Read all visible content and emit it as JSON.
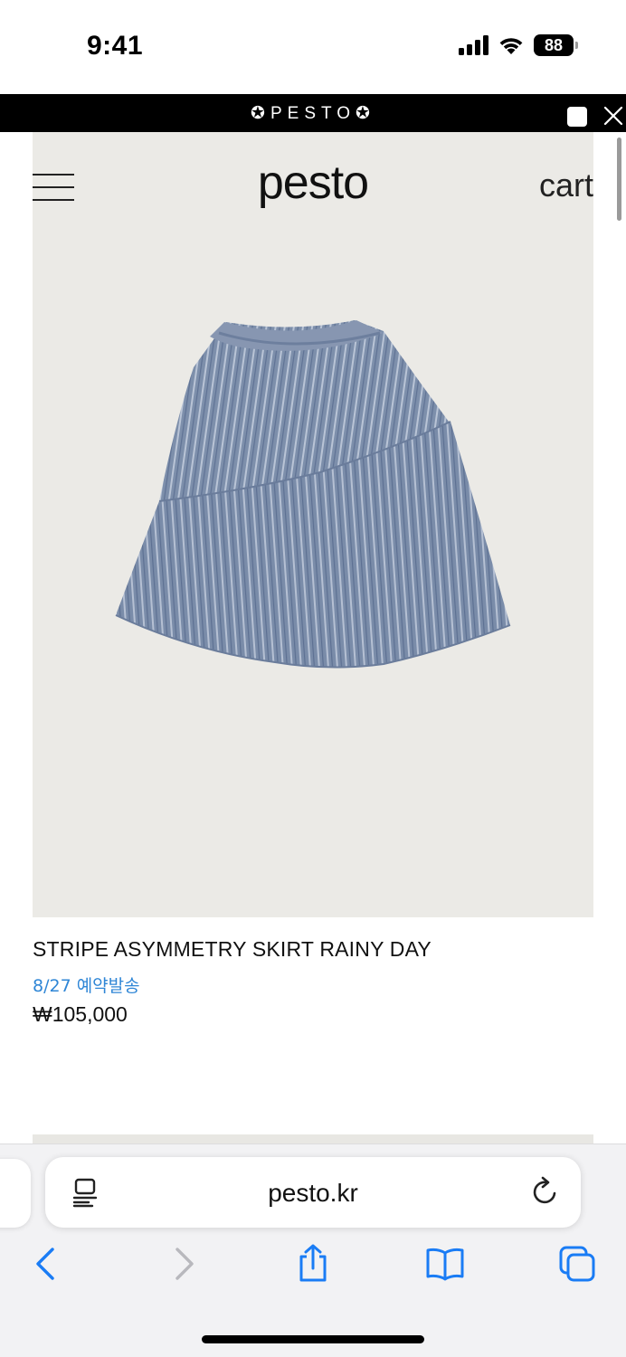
{
  "status_bar": {
    "time": "9:41",
    "battery": "88"
  },
  "banner": {
    "text": "✪PESTO✪"
  },
  "header": {
    "logo": "pesto",
    "cart_label": "cart"
  },
  "product": {
    "name": "STRIPE ASYMMETRY SKIRT RAINY DAY",
    "shipping_note": "8/27 예약발송",
    "price": "₩105,000"
  },
  "browser": {
    "url": "pesto.kr"
  },
  "colors": {
    "accent_blue": "#2f86d6",
    "hero_bg": "#ebeae6",
    "safari_blue": "#1a7cf5"
  },
  "icons": [
    "hamburger-icon",
    "close-icon",
    "reader-icon",
    "reload-icon",
    "back-icon",
    "forward-icon",
    "share-icon",
    "bookmarks-icon",
    "tabs-icon"
  ]
}
